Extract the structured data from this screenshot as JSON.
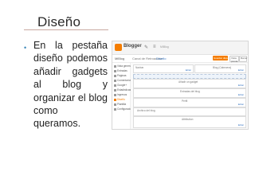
{
  "slide": {
    "title": "Diseño",
    "bullet_text": "En la pestaña diseño podemos añadir gadgets al blog y organizar el blog como queramos.",
    "bullet_symbol": "•",
    "bullet_color": "#3a86b8"
  },
  "screenshot": {
    "app_name": "Blogger",
    "toolbar_icons": [
      "pencil-icon",
      "list-icon"
    ],
    "blog_name": "MiBlog",
    "breadcrumb_1": "Canal de Retroacción",
    "breadcrumb_2": "Diseño",
    "buttons": {
      "save": "Guardar disposición",
      "preview": "Vista previa",
      "clear": "Borrar"
    },
    "sidebar_items": [
      {
        "label": "Vista general",
        "active": false
      },
      {
        "label": "Entradas",
        "active": false
      },
      {
        "label": "Páginas",
        "active": false
      },
      {
        "label": "Comentarios",
        "active": false
      },
      {
        "label": "Google+",
        "active": false
      },
      {
        "label": "Estadísticas",
        "active": false
      },
      {
        "label": "Ingresos",
        "active": false
      },
      {
        "label": "Diseño",
        "active": true
      },
      {
        "label": "Plantilla",
        "active": false
      },
      {
        "label": "Configuración",
        "active": false
      }
    ],
    "gadgets": {
      "navbar": "Navbar",
      "header": "Blog (Cabecera)",
      "add_gadget_1": "Añadir un gadget",
      "blog_posts": "Entradas del blog",
      "add_gadget_2": "Añadir un gadget",
      "profile": "Perfil",
      "archive": "Archivo del blog",
      "attribution": "Attribution",
      "edit": "Editar"
    },
    "accent_color": "#f57d00"
  }
}
